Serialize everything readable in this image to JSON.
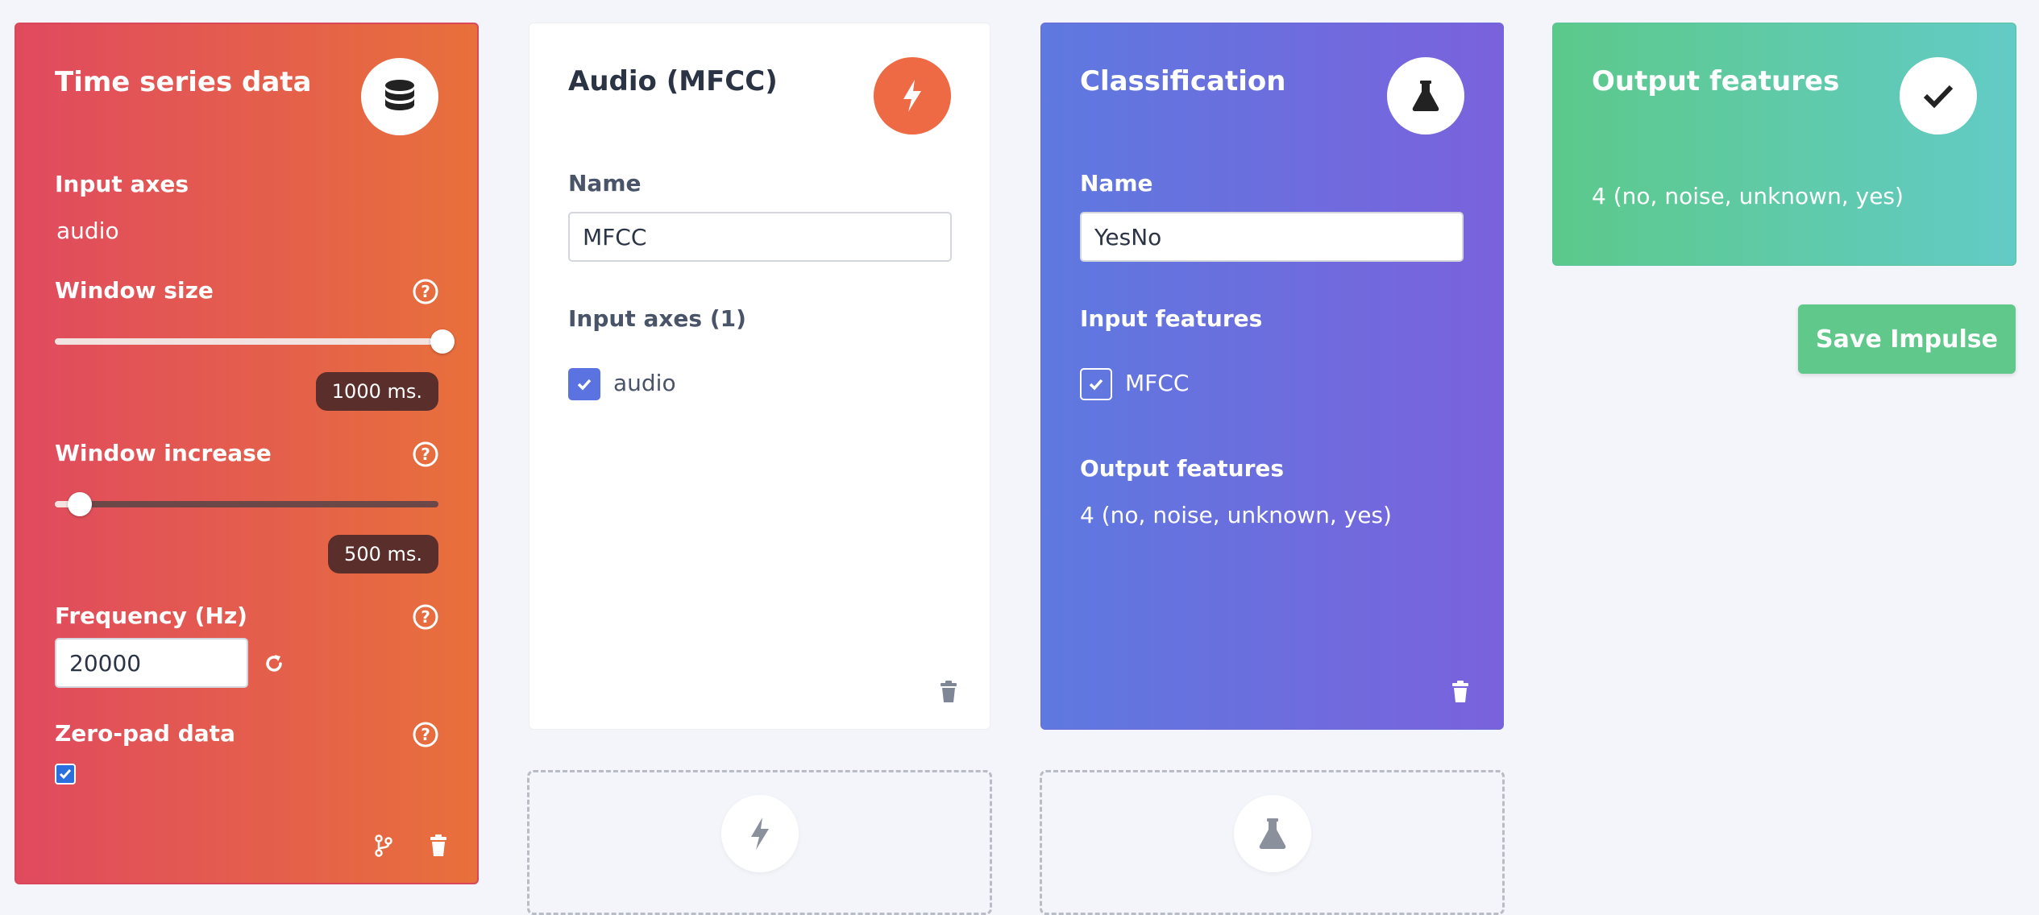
{
  "time_series": {
    "title": "Time series data",
    "icon": "database-icon",
    "input_axes_label": "Input axes",
    "input_axes_value": "audio",
    "window_size_label": "Window size",
    "window_size_value": "1000 ms.",
    "window_size_level": 1.0,
    "window_increase_label": "Window increase",
    "window_increase_value": "500 ms.",
    "window_increase_level": 0.06,
    "frequency_label": "Frequency (Hz)",
    "frequency_value": "20000",
    "zero_pad_label": "Zero-pad data",
    "zero_pad_checked": true
  },
  "audio_block": {
    "title": "Audio (MFCC)",
    "icon": "lightning-icon",
    "name_label": "Name",
    "name_value": "MFCC",
    "input_axes_label": "Input axes (1)",
    "axis_item": "audio"
  },
  "classification": {
    "title": "Classification",
    "icon": "flask-icon",
    "name_label": "Name",
    "name_value": "YesNo",
    "input_features_label": "Input features",
    "feature_item": "MFCC",
    "output_features_label": "Output features",
    "output_features_value": "4 (no, noise, unknown, yes)"
  },
  "output": {
    "title": "Output features",
    "icon": "check-icon",
    "value": "4 (no, noise, unknown, yes)"
  },
  "save_button": "Save Impulse",
  "colors": {
    "red_start": "#e04a5f",
    "red_end": "#e8703b",
    "purple_start": "#5e79e0",
    "purple_end": "#7a62dc",
    "green_start": "#5cc98a",
    "green_end": "#63cbc6",
    "orange_icon": "#ed6a44"
  }
}
